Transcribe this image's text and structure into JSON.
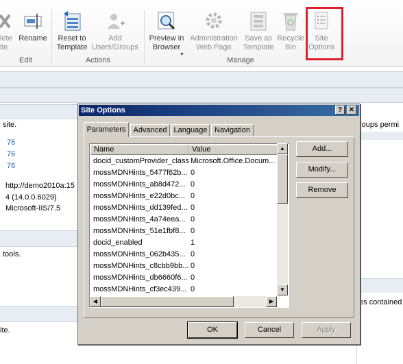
{
  "ribbon": {
    "buttons": {
      "delete_site": "lete\nite",
      "rename": "Rename",
      "reset_to_template": "Reset to\nTemplate",
      "add_users_groups": "Add\nUsers/Groups",
      "preview_in_browser": "Preview in\nBrowser",
      "admin_web_page": "Administration\nWeb Page",
      "save_as_template": "Save as\nTemplate",
      "recycle_bin": "Recycle\nBin",
      "site_options": "Site\nOptions"
    },
    "groups": {
      "edit": "Edit",
      "actions": "Actions",
      "manage": "Manage"
    }
  },
  "background": {
    "site_text": "site.",
    "numbers": [
      "76",
      "76",
      "76"
    ],
    "url_text": "http://demo2010a:15",
    "version": "4 (14.0.0.6029)",
    "server": "Microsoft-IIS/7.5",
    "tools_text": "tools.",
    "ite_text": "ite.",
    "groups_perm": "roups permi",
    "files_contained": "es contained"
  },
  "dialog": {
    "title": "Site Options",
    "help_label": "?",
    "close_label": "✕",
    "tabs": [
      "Parameters",
      "Advanced",
      "Language",
      "Navigation"
    ],
    "columns": [
      "Name",
      "Value"
    ],
    "rows": [
      {
        "name": "docid_customProvider_class",
        "value": "Microsoft.Office.Docum..."
      },
      {
        "name": "mossMDNHints_5477f62b...",
        "value": "0"
      },
      {
        "name": "mossMDNHints_ab8d472...",
        "value": "0"
      },
      {
        "name": "mossMDNHints_e22d0bc...",
        "value": "0"
      },
      {
        "name": "mossMDNHints_dd139fed...",
        "value": "0"
      },
      {
        "name": "mossMDNHints_4a74eea...",
        "value": "0"
      },
      {
        "name": "mossMDNHints_51e1fbf8...",
        "value": "0"
      },
      {
        "name": "docid_enabled",
        "value": "1"
      },
      {
        "name": "mossMDNHints_062b435...",
        "value": "0"
      },
      {
        "name": "mossMDNHints_c8cbb9bb...",
        "value": "0"
      },
      {
        "name": "mossMDNHints_db6660f6...",
        "value": "0"
      },
      {
        "name": "mossMDNHints_cf3ec439...",
        "value": "0"
      }
    ],
    "side_buttons": {
      "add": "Add...",
      "modify": "Modify...",
      "remove": "Remove"
    },
    "footer_buttons": {
      "ok": "OK",
      "cancel": "Cancel",
      "apply": "Apply"
    }
  },
  "colors": {
    "highlight": "#e0202c",
    "title_bar": "#0a246a"
  }
}
